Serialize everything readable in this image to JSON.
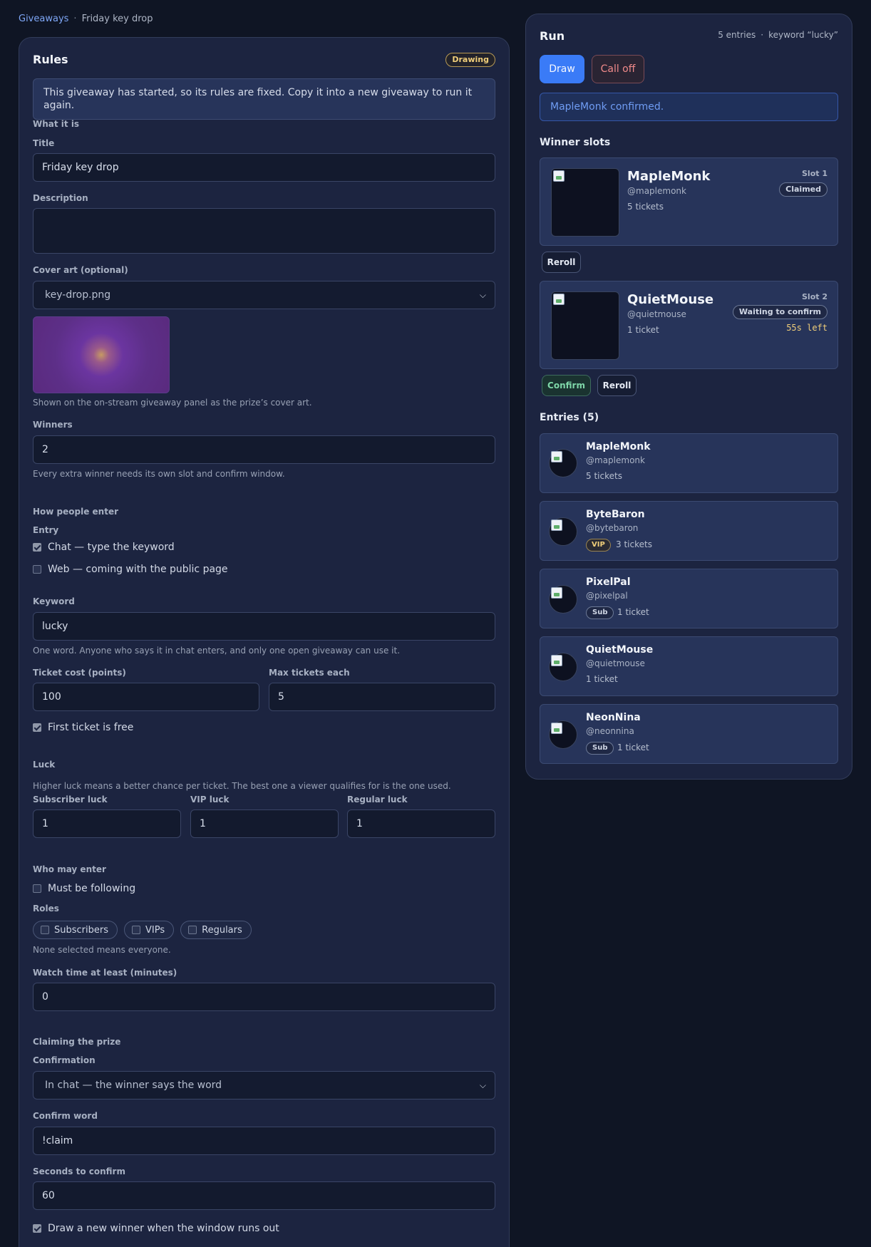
{
  "breadcrumb": {
    "root": "Giveaways",
    "separator": "·",
    "current": "Friday key drop"
  },
  "rules": {
    "title": "Rules",
    "status_badge": "Drawing",
    "notice": "This giveaway has started, so its rules are fixed. Copy it into a new giveaway to run it again.",
    "what": {
      "heading": "What it is",
      "title_label": "Title",
      "title_value": "Friday key drop",
      "description_label": "Description",
      "description_value": "",
      "cover_label": "Cover art (optional)",
      "cover_value": "key-drop.png",
      "cover_help": "Shown on the on-stream giveaway panel as the prize’s cover art.",
      "winners_label": "Winners",
      "winners_value": "2",
      "winners_help": "Every extra winner needs its own slot and confirm window."
    },
    "enter": {
      "heading": "How people enter",
      "entry_label": "Entry",
      "chat_option": {
        "label": "Chat — type the keyword",
        "checked": true
      },
      "web_option": {
        "label": "Web — coming with the public page",
        "checked": false
      },
      "keyword_label": "Keyword",
      "keyword_value": "lucky",
      "keyword_help": "One word. Anyone who says it in chat enters, and only one open giveaway can use it.",
      "ticket_cost_label": "Ticket cost (points)",
      "ticket_cost_value": "100",
      "max_tickets_label": "Max tickets each",
      "max_tickets_value": "5",
      "first_free": {
        "label": "First ticket is free",
        "checked": true
      }
    },
    "luck": {
      "heading": "Luck",
      "help": "Higher luck means a better chance per ticket. The best one a viewer qualifies for is the one used.",
      "subscriber_label": "Subscriber luck",
      "subscriber_value": "1",
      "vip_label": "VIP luck",
      "vip_value": "1",
      "regular_label": "Regular luck",
      "regular_value": "1"
    },
    "who": {
      "heading": "Who may enter",
      "following": {
        "label": "Must be following",
        "checked": false
      },
      "roles_label": "Roles",
      "roles": [
        {
          "label": "Subscribers",
          "checked": false
        },
        {
          "label": "VIPs",
          "checked": false
        },
        {
          "label": "Regulars",
          "checked": false
        }
      ],
      "roles_help": "None selected means everyone.",
      "watch_label": "Watch time at least (minutes)",
      "watch_value": "0"
    },
    "claim": {
      "heading": "Claiming the prize",
      "confirmation_label": "Confirmation",
      "confirmation_value": "In chat — the winner says the word",
      "confirm_word_label": "Confirm word",
      "confirm_word_value": "!claim",
      "seconds_label": "Seconds to confirm",
      "seconds_value": "60",
      "redraw": {
        "label": "Draw a new winner when the window runs out",
        "checked": true
      }
    }
  },
  "run": {
    "title": "Run",
    "entries_count": "5 entries",
    "keyword_meta": "keyword “lucky”",
    "draw_label": "Draw",
    "calloff_label": "Call off",
    "message": "MapleMonk confirmed.",
    "slots_heading": "Winner slots",
    "slots": [
      {
        "name": "MapleMonk",
        "handle": "@maplemonk",
        "tickets": "5 tickets",
        "slot": "Slot 1",
        "status": "Claimed",
        "countdown": "",
        "actions": [
          "Reroll"
        ]
      },
      {
        "name": "QuietMouse",
        "handle": "@quietmouse",
        "tickets": "1 ticket",
        "slot": "Slot 2",
        "status": "Waiting to confirm",
        "countdown": "55s left",
        "actions": [
          "Confirm",
          "Reroll"
        ]
      }
    ],
    "entries_heading": "Entries (5)",
    "entries": [
      {
        "name": "MapleMonk",
        "handle": "@maplemonk",
        "badge": "",
        "tickets": "5 tickets"
      },
      {
        "name": "ByteBaron",
        "handle": "@bytebaron",
        "badge": "VIP",
        "tickets": "3 tickets"
      },
      {
        "name": "PixelPal",
        "handle": "@pixelpal",
        "badge": "Sub",
        "tickets": "1 ticket"
      },
      {
        "name": "QuietMouse",
        "handle": "@quietmouse",
        "badge": "",
        "tickets": "1 ticket"
      },
      {
        "name": "NeonNina",
        "handle": "@neonnina",
        "badge": "Sub",
        "tickets": "1 ticket"
      }
    ]
  },
  "colors": {
    "background": "#0f1524",
    "panel": "#1c2440",
    "accent": "#3a7bf7",
    "danger": "#f08a8a",
    "success": "#7ed6a8",
    "warning": "#f0ce7a"
  },
  "icons": {
    "select_chevron": "chevron-down-icon",
    "checkbox_checked": "checkbox-checked-icon",
    "checkbox_unchecked": "checkbox-unchecked-icon",
    "broken_image": "broken-image-icon"
  }
}
